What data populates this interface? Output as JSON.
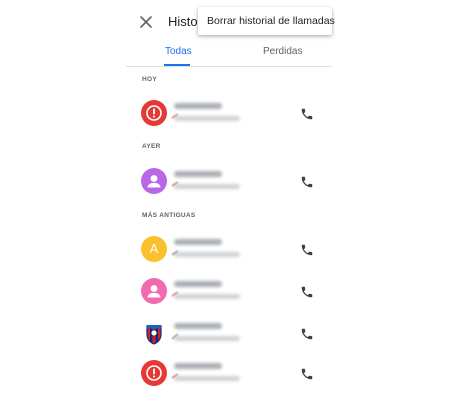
{
  "header": {
    "title": "Histori",
    "menu_item": "Borrar historial de llamadas"
  },
  "tabs": [
    {
      "label": "Todas",
      "active": true
    },
    {
      "label": "Perdidas",
      "active": false
    }
  ],
  "sections": [
    {
      "label": "HOY"
    },
    {
      "label": "AYER"
    },
    {
      "label": "MÁS ANTIGUAS"
    }
  ],
  "colors": {
    "accent": "#1a73e8",
    "red": "#e53935",
    "purple": "#b868e6",
    "yellow": "#fbc02d",
    "pink": "#f06bb0"
  },
  "calls": [
    {
      "avatar": "alert-icon",
      "avatar_color": "#e53935"
    },
    {
      "avatar": "person-icon",
      "avatar_color": "#b868e6"
    },
    {
      "avatar": "A",
      "avatar_color": "#fbc02d"
    },
    {
      "avatar": "person-icon",
      "avatar_color": "#f06bb0"
    },
    {
      "avatar": "club-crest-image",
      "avatar_color": "#ffffff"
    },
    {
      "avatar": "alert-icon",
      "avatar_color": "#e53935"
    }
  ]
}
